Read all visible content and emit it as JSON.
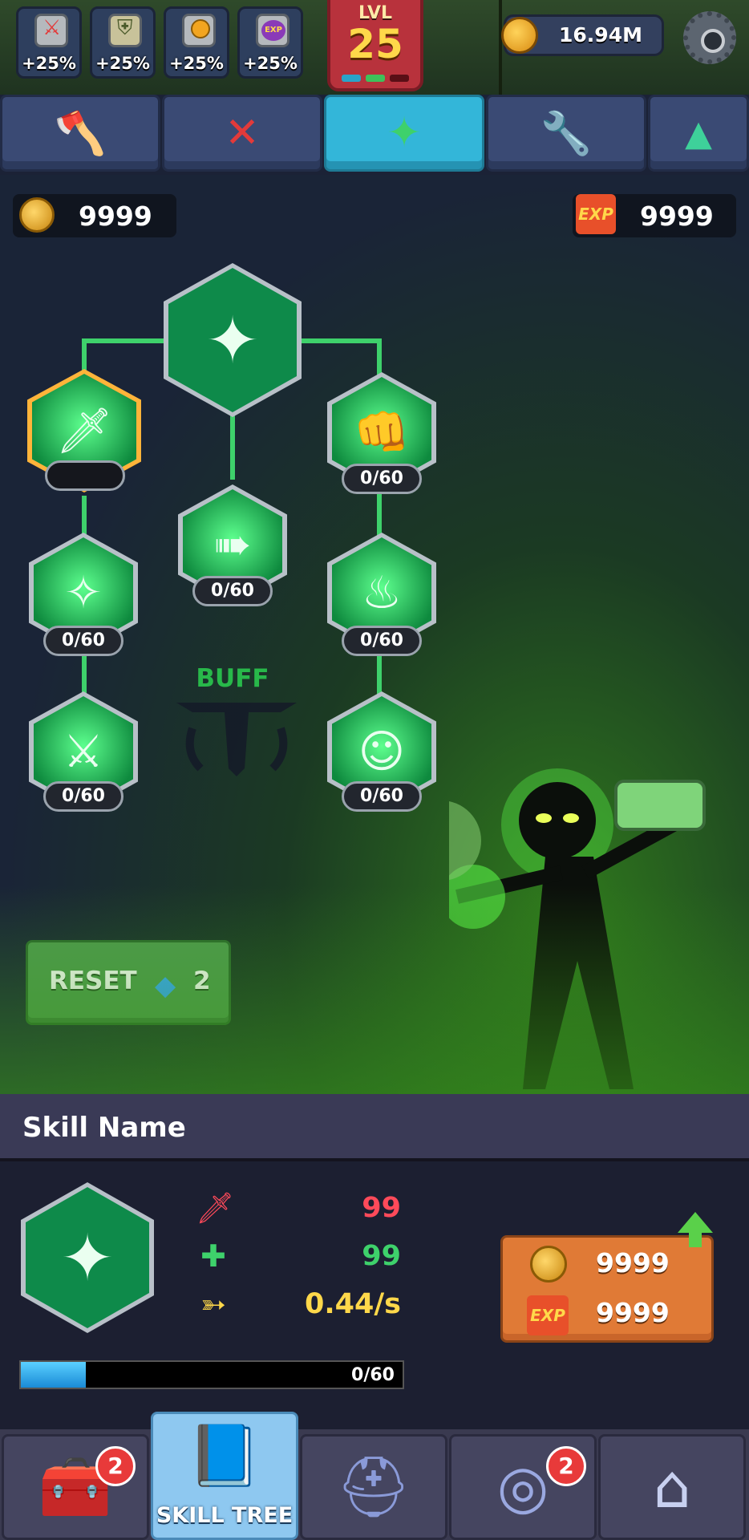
{
  "top_bar": {
    "buffs": [
      {
        "icon": "sword-icon",
        "value": "+25%"
      },
      {
        "icon": "shield-icon",
        "value": "+25%"
      },
      {
        "icon": "coin-icon",
        "value": "+25%"
      },
      {
        "icon": "exp-icon",
        "value": "+25%"
      }
    ],
    "level_label": "LVL",
    "level_value": "25",
    "coins": "16.94M"
  },
  "tabs": [
    {
      "icon": "axe-icon",
      "active": false
    },
    {
      "icon": "crossbow-icon",
      "active": false
    },
    {
      "icon": "wand-icon",
      "active": true
    },
    {
      "icon": "wrench-icon",
      "active": false
    },
    {
      "icon": "triangle-up-icon",
      "active": false
    }
  ],
  "currency": {
    "gold": "9999",
    "exp": "9999",
    "exp_badge": "EXP"
  },
  "tree": {
    "category_label": "BUFF",
    "nodes": [
      {
        "id": "root",
        "icon": "wand-icon",
        "level": ""
      },
      {
        "id": "left-1",
        "icon": "sword-icon",
        "level": ""
      },
      {
        "id": "right-1",
        "icon": "punch-icon",
        "level": "0/60"
      },
      {
        "id": "mid-2",
        "icon": "dash-icon",
        "level": "0/60"
      },
      {
        "id": "left-2",
        "icon": "portal-icon",
        "level": "0/60"
      },
      {
        "id": "right-2",
        "icon": "power-up-icon",
        "level": "0/60"
      },
      {
        "id": "left-3",
        "icon": "sword-strike-icon",
        "level": "0/60"
      },
      {
        "id": "right-3",
        "icon": "halo-icon",
        "level": "0/60"
      }
    ]
  },
  "reset": {
    "label": "RESET",
    "cost": "2"
  },
  "details": {
    "skill_name": "Skill Name",
    "stats": [
      {
        "icon": "sword-icon",
        "value": "99",
        "color": "#ff4a5a"
      },
      {
        "icon": "heal-icon",
        "value": "99",
        "color": "#3ed16b"
      },
      {
        "icon": "speed-icon",
        "value": "0.44/s",
        "color": "#ffd84a"
      }
    ],
    "cost_gold": "9999",
    "cost_exp": "9999",
    "progress_text": "0/60",
    "progress_fraction": 0.17
  },
  "bottom_nav": {
    "items": [
      {
        "icon": "chest-icon",
        "badge": "2",
        "label": ""
      },
      {
        "icon": "skill-book-icon",
        "badge": "",
        "label": "SKILL TREE"
      },
      {
        "icon": "helmet-icon",
        "badge": "",
        "label": ""
      },
      {
        "icon": "ring-icon",
        "badge": "2",
        "label": ""
      },
      {
        "icon": "house-icon",
        "badge": "",
        "label": ""
      }
    ]
  },
  "colors": {
    "accent": "#33b6d9",
    "tree_green": "#3ed16b",
    "cost_orange": "#e07a36",
    "selected_glow": "#ffb43a"
  }
}
